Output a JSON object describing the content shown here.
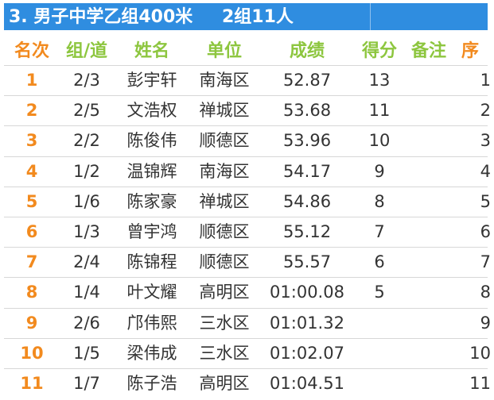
{
  "title": {
    "main": "3. 男子中学乙组400米",
    "sub": "2组11人"
  },
  "colors": {
    "title_bg": "#2f8de0",
    "header_orange": "#f28a1e",
    "header_green": "#8dc63f",
    "rank_orange": "#f28a1e",
    "text": "#333333"
  },
  "headers": {
    "rank": "名次",
    "group": "组/道",
    "name": "姓名",
    "unit": "单位",
    "result": "成绩",
    "score": "得分",
    "note": "备注",
    "seq": "序"
  },
  "rows": [
    {
      "rank": "1",
      "group": "2/3",
      "name": "彭宇轩",
      "unit": "南海区",
      "result": "52.87",
      "score": "13",
      "note": "",
      "seq": "1"
    },
    {
      "rank": "2",
      "group": "2/5",
      "name": "文浩权",
      "unit": "禅城区",
      "result": "53.68",
      "score": "11",
      "note": "",
      "seq": "2"
    },
    {
      "rank": "3",
      "group": "2/2",
      "name": "陈俊伟",
      "unit": "顺德区",
      "result": "53.96",
      "score": "10",
      "note": "",
      "seq": "3"
    },
    {
      "rank": "4",
      "group": "1/2",
      "name": "温锦辉",
      "unit": "南海区",
      "result": "54.17",
      "score": "9",
      "note": "",
      "seq": "4"
    },
    {
      "rank": "5",
      "group": "1/6",
      "name": "陈家豪",
      "unit": "禅城区",
      "result": "54.86",
      "score": "8",
      "note": "",
      "seq": "5"
    },
    {
      "rank": "6",
      "group": "1/3",
      "name": "曾宇鸿",
      "unit": "顺德区",
      "result": "55.12",
      "score": "7",
      "note": "",
      "seq": "6"
    },
    {
      "rank": "7",
      "group": "2/4",
      "name": "陈锦程",
      "unit": "顺德区",
      "result": "55.57",
      "score": "6",
      "note": "",
      "seq": "7"
    },
    {
      "rank": "8",
      "group": "1/4",
      "name": "叶文耀",
      "unit": "高明区",
      "result": "01:00.08",
      "score": "5",
      "note": "",
      "seq": "8"
    },
    {
      "rank": "9",
      "group": "2/6",
      "name": "邝伟熙",
      "unit": "三水区",
      "result": "01:01.32",
      "score": "",
      "note": "",
      "seq": "9"
    },
    {
      "rank": "10",
      "group": "1/5",
      "name": "梁伟成",
      "unit": "三水区",
      "result": "01:02.07",
      "score": "",
      "note": "",
      "seq": "10"
    },
    {
      "rank": "11",
      "group": "1/7",
      "name": "陈子浩",
      "unit": "高明区",
      "result": "01:04.51",
      "score": "",
      "note": "",
      "seq": "11"
    }
  ]
}
